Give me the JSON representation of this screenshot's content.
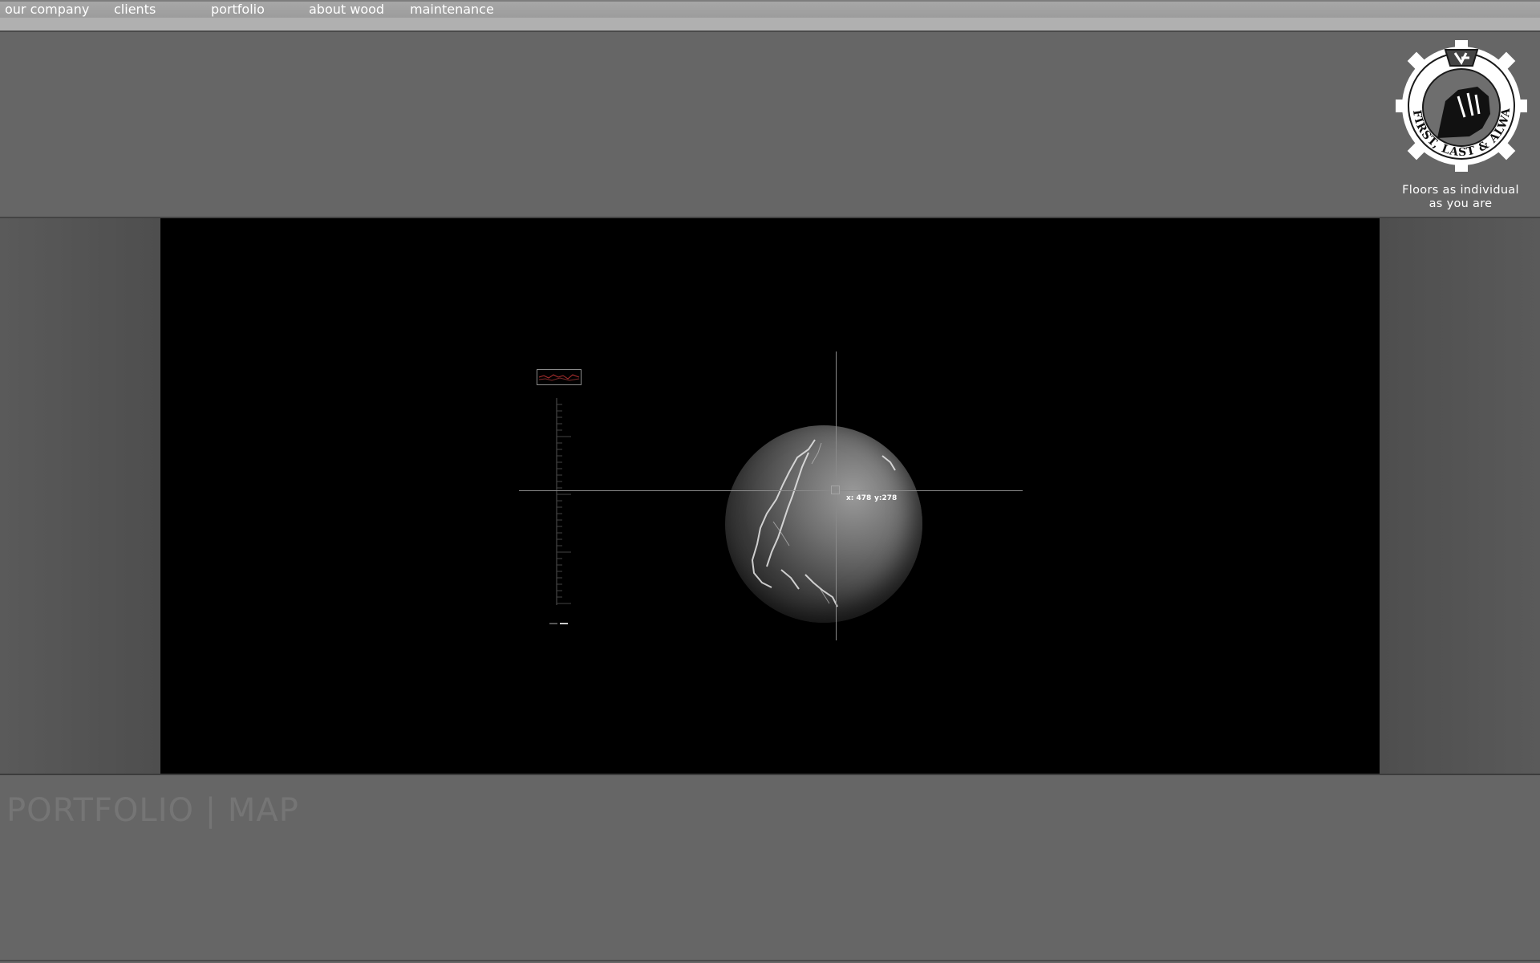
{
  "nav": {
    "items": [
      {
        "label": "our company"
      },
      {
        "label": "clients"
      },
      {
        "label": "portfolio"
      },
      {
        "label": "about wood"
      },
      {
        "label": "maintenance"
      }
    ]
  },
  "logo": {
    "text": "FIRST, LAST & ALWAYS",
    "tagline_line1": "Floors as individual",
    "tagline_line2": "as you are"
  },
  "map": {
    "coord_x": "x: 478",
    "coord_y": "y:278"
  },
  "page": {
    "title": "PORTFOLIO | MAP"
  },
  "colors": {
    "page_bg": "#666666",
    "nav_bg": "#a7a7a7",
    "viewer_bg": "#000000",
    "title_color": "#757575",
    "zoom_accent": "#b03030"
  }
}
